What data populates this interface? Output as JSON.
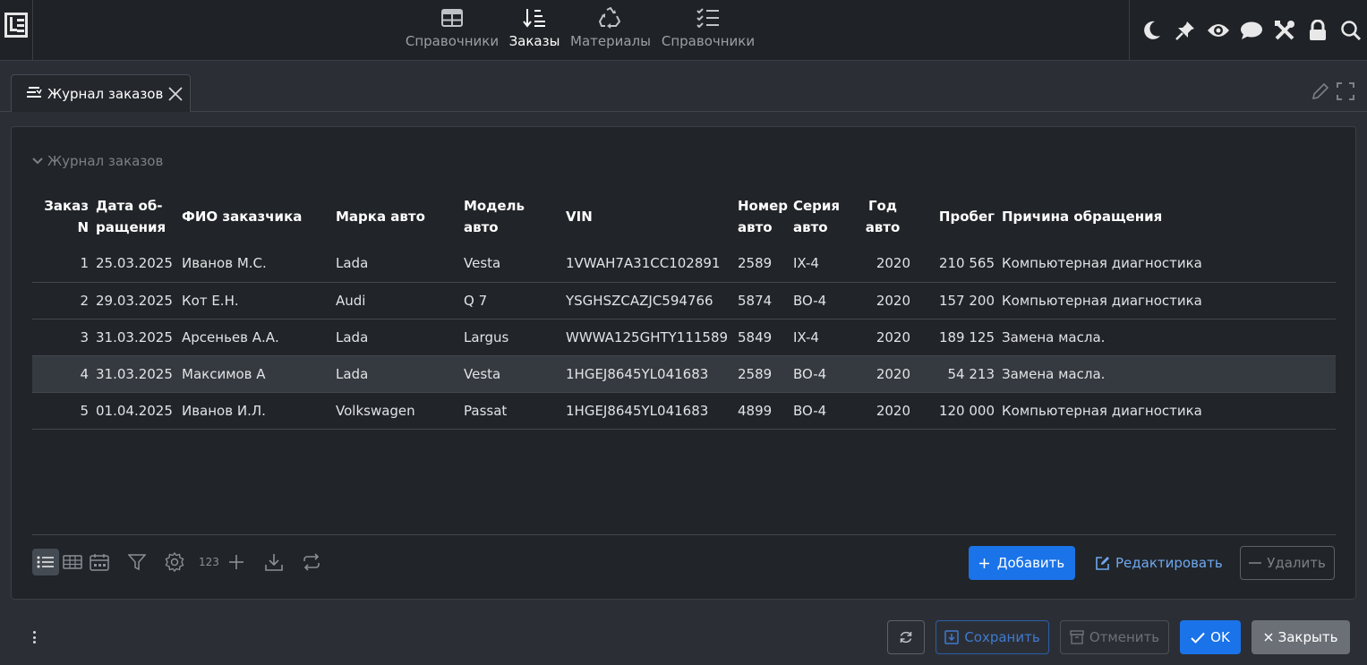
{
  "app": {
    "nav": [
      {
        "label": "Справочники",
        "icon": "table-icon",
        "active": false
      },
      {
        "label": "Заказы",
        "icon": "sort-list-icon",
        "active": true
      },
      {
        "label": "Материалы",
        "icon": "recycle-icon",
        "active": false
      },
      {
        "label": "Справочники",
        "icon": "checklist-icon",
        "active": false
      }
    ],
    "right_tools": [
      "moon-icon",
      "pin-icon",
      "eye-icon",
      "chat-icon",
      "tools-icon",
      "lock-icon",
      "search-icon"
    ]
  },
  "tab": {
    "label": "Журнал заказов"
  },
  "section": {
    "title": "Журнал заказов"
  },
  "table": {
    "columns": [
      "Заказ N",
      "Дата об-ращения",
      "ФИО заказчика",
      "Марка авто",
      "Модель авто",
      "VIN",
      "Номер авто",
      "Серия авто",
      "Год авто",
      "Пробег",
      "Причина обращения"
    ],
    "rows": [
      {
        "n": "1",
        "date": "25.03.2025",
        "fio": " Иванов М.С.",
        "brand": "Lada",
        "model": "Vesta",
        "vin": "1VWAH7A31CC102891",
        "number": "2589",
        "series": "IX-4",
        "year": "2020",
        "mileage": "210 565",
        "reason": "Компьютерная диагностика"
      },
      {
        "n": "2",
        "date": "29.03.2025",
        "fio": "Кот Е.Н.",
        "brand": "Audi",
        "model": "Q 7",
        "vin": "YSGHSZCAZJC594766",
        "number": "5874",
        "series": "BO-4",
        "year": "2020",
        "mileage": "157 200",
        "reason": "Компьютерная диагностика"
      },
      {
        "n": "3",
        "date": "31.03.2025",
        "fio": "Арсеньев А.А.",
        "brand": "Lada",
        "model": "Largus",
        "vin": "WWWA125GHTY111589",
        "number": "5849",
        "series": "IX-4",
        "year": "2020",
        "mileage": "189 125",
        "reason": " Замена масла."
      },
      {
        "n": "4",
        "date": "31.03.2025",
        "fio": "Максимов А",
        "brand": "Lada",
        "model": "Vesta",
        "vin": "1HGEJ8645YL041683",
        "number": "2589",
        "series": "BO-4",
        "year": "2020",
        "mileage": "54 213",
        "reason": " Замена масла."
      },
      {
        "n": "5",
        "date": "01.04.2025",
        "fio": " Иванов И.Л.",
        "brand": "Volkswagen",
        "model": "Passat",
        "vin": "1HGEJ8645YL041683",
        "number": "4899",
        "series": "BO-4",
        "year": "2020",
        "mileage": "120 000",
        "reason": "Компьютерная диагностика"
      }
    ],
    "selected_row": 4
  },
  "toolbar": {
    "counter_label": "123",
    "add_label": "Добавить",
    "edit_label": "Редактировать",
    "delete_label": "Удалить"
  },
  "footer": {
    "save_label": "Сохранить",
    "cancel_label": "Отменить",
    "ok_label": "OK",
    "close_label": "Закрыть"
  },
  "colors": {
    "accent": "#1a73e8",
    "background": "#2b2f35",
    "panel": "#212428"
  }
}
